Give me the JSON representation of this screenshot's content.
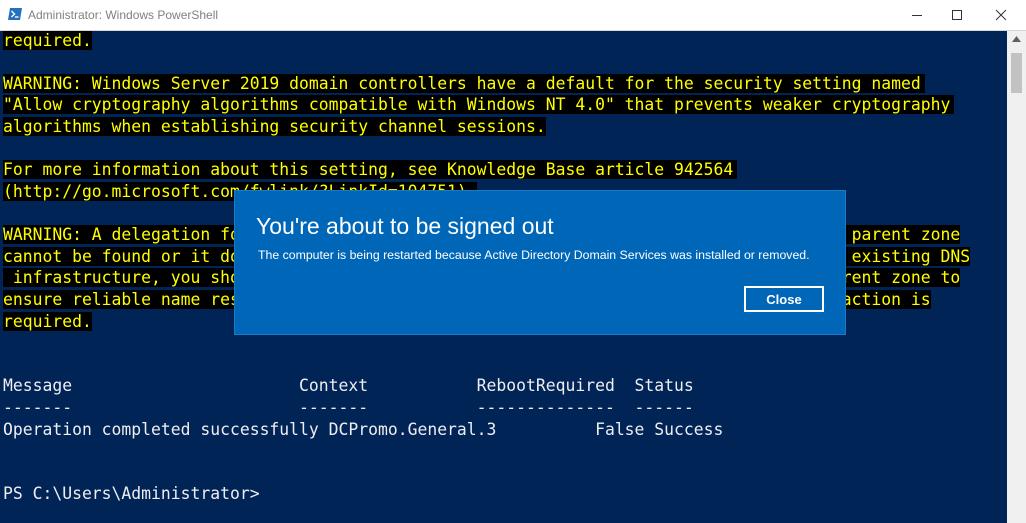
{
  "window": {
    "title": "Administrator: Windows PowerShell"
  },
  "console": {
    "lines": [
      "required.",
      "WARNING: Windows Server 2019 domain controllers have a default for the security setting named",
      "\"Allow cryptography algorithms compatible with Windows NT 4.0\" that prevents weaker cryptography",
      "algorithms when establishing security channel sessions.",
      "For more information about this setting, see Knowledge Base article 942564",
      "(http://go.microsoft.com/fwlink/?LinkId=104751).",
      "WARNING: A delegation for this DNS server cannot be created because the authoritative parent zone",
      "cannot be found or it does not run Windows DNS server. If you are integrating with an existing DNS",
      " infrastructure, you should manually create a delegation to this DNS server in the parent zone to",
      "ensure reliable name resolution from outside the domain \"contoso.com\". Otherwise, no action is",
      "required."
    ],
    "result_header": "Message                       Context           RebootRequired  Status",
    "result_separator": "-------                       -------           --------------  ------",
    "result_row": "Operation completed successfully DCPromo.General.3          False Success",
    "prompt": "PS C:\\Users\\Administrator>"
  },
  "dialog": {
    "title": "You're about to be signed out",
    "message": "The computer is being restarted because Active Directory Domain Services was installed or removed.",
    "close_label": "Close"
  },
  "colors": {
    "console_bg": "#012456",
    "warning_fg": "#ffff00",
    "warning_bg": "#000000",
    "dialog_bg": "#0067b8"
  }
}
